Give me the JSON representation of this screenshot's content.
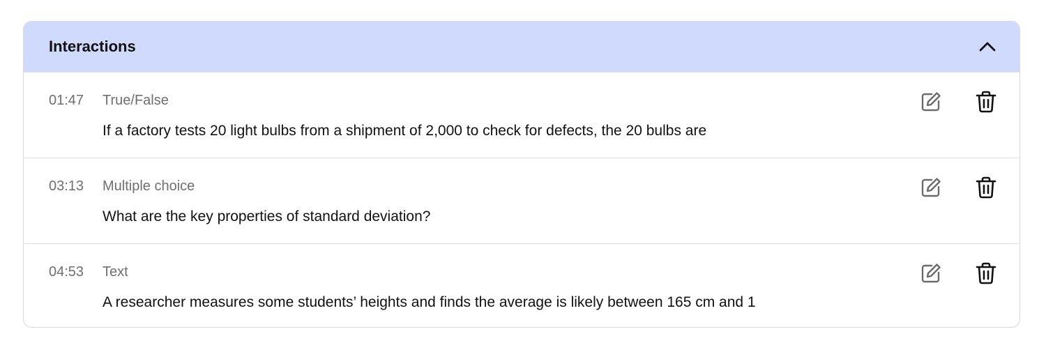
{
  "panel": {
    "title": "Interactions",
    "collapse_icon": "chevron-up-icon"
  },
  "interactions": [
    {
      "time": "01:47",
      "type": "True/False",
      "question": "If a factory tests 20 light bulbs from a shipment of 2,000 to check for defects, the 20 bulbs are"
    },
    {
      "time": "03:13",
      "type": "Multiple choice",
      "question": "What are the key properties of standard deviation?"
    },
    {
      "time": "04:53",
      "type": "Text",
      "question": "A researcher measures some students’ heights and finds the average is likely between 165 cm and 1"
    }
  ],
  "icons": {
    "edit": "edit-icon",
    "delete": "trash-icon"
  },
  "colors": {
    "header_bg": "#d0dafc",
    "meta_text": "#6f6f6f",
    "body_text": "#111111",
    "edit_icon": "#6b6b6b",
    "delete_icon": "#111111"
  }
}
